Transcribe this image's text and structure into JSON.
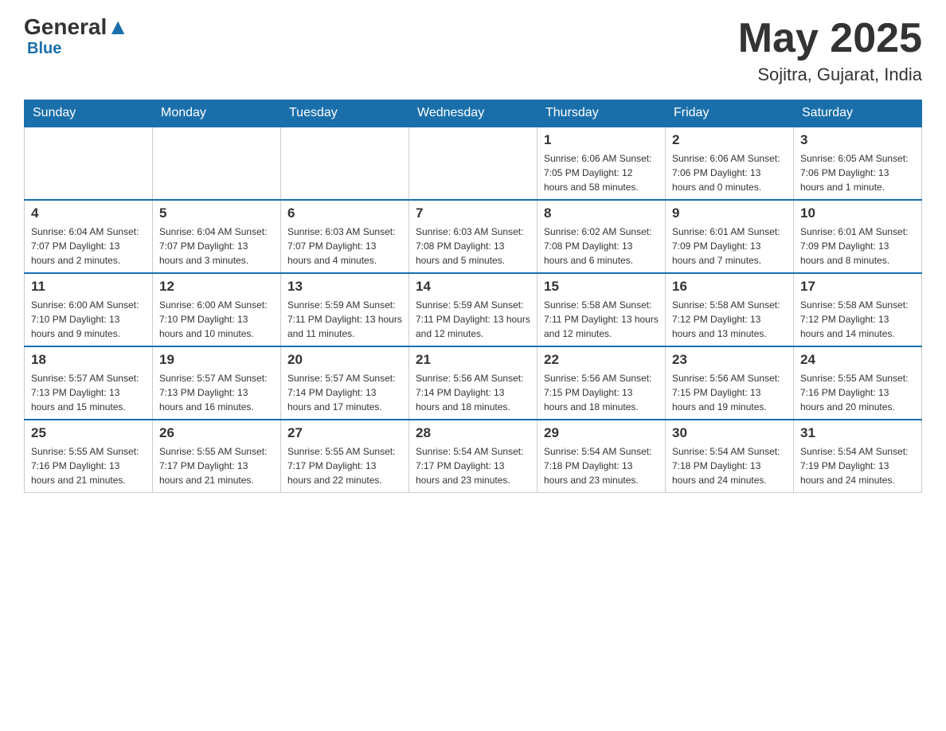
{
  "header": {
    "logo_general": "General",
    "logo_blue": "Blue",
    "month_year": "May 2025",
    "location": "Sojitra, Gujarat, India"
  },
  "days_of_week": [
    "Sunday",
    "Monday",
    "Tuesday",
    "Wednesday",
    "Thursday",
    "Friday",
    "Saturday"
  ],
  "weeks": [
    [
      {
        "day": "",
        "info": ""
      },
      {
        "day": "",
        "info": ""
      },
      {
        "day": "",
        "info": ""
      },
      {
        "day": "",
        "info": ""
      },
      {
        "day": "1",
        "info": "Sunrise: 6:06 AM\nSunset: 7:05 PM\nDaylight: 12 hours\nand 58 minutes."
      },
      {
        "day": "2",
        "info": "Sunrise: 6:06 AM\nSunset: 7:06 PM\nDaylight: 13 hours\nand 0 minutes."
      },
      {
        "day": "3",
        "info": "Sunrise: 6:05 AM\nSunset: 7:06 PM\nDaylight: 13 hours\nand 1 minute."
      }
    ],
    [
      {
        "day": "4",
        "info": "Sunrise: 6:04 AM\nSunset: 7:07 PM\nDaylight: 13 hours\nand 2 minutes."
      },
      {
        "day": "5",
        "info": "Sunrise: 6:04 AM\nSunset: 7:07 PM\nDaylight: 13 hours\nand 3 minutes."
      },
      {
        "day": "6",
        "info": "Sunrise: 6:03 AM\nSunset: 7:07 PM\nDaylight: 13 hours\nand 4 minutes."
      },
      {
        "day": "7",
        "info": "Sunrise: 6:03 AM\nSunset: 7:08 PM\nDaylight: 13 hours\nand 5 minutes."
      },
      {
        "day": "8",
        "info": "Sunrise: 6:02 AM\nSunset: 7:08 PM\nDaylight: 13 hours\nand 6 minutes."
      },
      {
        "day": "9",
        "info": "Sunrise: 6:01 AM\nSunset: 7:09 PM\nDaylight: 13 hours\nand 7 minutes."
      },
      {
        "day": "10",
        "info": "Sunrise: 6:01 AM\nSunset: 7:09 PM\nDaylight: 13 hours\nand 8 minutes."
      }
    ],
    [
      {
        "day": "11",
        "info": "Sunrise: 6:00 AM\nSunset: 7:10 PM\nDaylight: 13 hours\nand 9 minutes."
      },
      {
        "day": "12",
        "info": "Sunrise: 6:00 AM\nSunset: 7:10 PM\nDaylight: 13 hours\nand 10 minutes."
      },
      {
        "day": "13",
        "info": "Sunrise: 5:59 AM\nSunset: 7:11 PM\nDaylight: 13 hours\nand 11 minutes."
      },
      {
        "day": "14",
        "info": "Sunrise: 5:59 AM\nSunset: 7:11 PM\nDaylight: 13 hours\nand 12 minutes."
      },
      {
        "day": "15",
        "info": "Sunrise: 5:58 AM\nSunset: 7:11 PM\nDaylight: 13 hours\nand 12 minutes."
      },
      {
        "day": "16",
        "info": "Sunrise: 5:58 AM\nSunset: 7:12 PM\nDaylight: 13 hours\nand 13 minutes."
      },
      {
        "day": "17",
        "info": "Sunrise: 5:58 AM\nSunset: 7:12 PM\nDaylight: 13 hours\nand 14 minutes."
      }
    ],
    [
      {
        "day": "18",
        "info": "Sunrise: 5:57 AM\nSunset: 7:13 PM\nDaylight: 13 hours\nand 15 minutes."
      },
      {
        "day": "19",
        "info": "Sunrise: 5:57 AM\nSunset: 7:13 PM\nDaylight: 13 hours\nand 16 minutes."
      },
      {
        "day": "20",
        "info": "Sunrise: 5:57 AM\nSunset: 7:14 PM\nDaylight: 13 hours\nand 17 minutes."
      },
      {
        "day": "21",
        "info": "Sunrise: 5:56 AM\nSunset: 7:14 PM\nDaylight: 13 hours\nand 18 minutes."
      },
      {
        "day": "22",
        "info": "Sunrise: 5:56 AM\nSunset: 7:15 PM\nDaylight: 13 hours\nand 18 minutes."
      },
      {
        "day": "23",
        "info": "Sunrise: 5:56 AM\nSunset: 7:15 PM\nDaylight: 13 hours\nand 19 minutes."
      },
      {
        "day": "24",
        "info": "Sunrise: 5:55 AM\nSunset: 7:16 PM\nDaylight: 13 hours\nand 20 minutes."
      }
    ],
    [
      {
        "day": "25",
        "info": "Sunrise: 5:55 AM\nSunset: 7:16 PM\nDaylight: 13 hours\nand 21 minutes."
      },
      {
        "day": "26",
        "info": "Sunrise: 5:55 AM\nSunset: 7:17 PM\nDaylight: 13 hours\nand 21 minutes."
      },
      {
        "day": "27",
        "info": "Sunrise: 5:55 AM\nSunset: 7:17 PM\nDaylight: 13 hours\nand 22 minutes."
      },
      {
        "day": "28",
        "info": "Sunrise: 5:54 AM\nSunset: 7:17 PM\nDaylight: 13 hours\nand 23 minutes."
      },
      {
        "day": "29",
        "info": "Sunrise: 5:54 AM\nSunset: 7:18 PM\nDaylight: 13 hours\nand 23 minutes."
      },
      {
        "day": "30",
        "info": "Sunrise: 5:54 AM\nSunset: 7:18 PM\nDaylight: 13 hours\nand 24 minutes."
      },
      {
        "day": "31",
        "info": "Sunrise: 5:54 AM\nSunset: 7:19 PM\nDaylight: 13 hours\nand 24 minutes."
      }
    ]
  ]
}
